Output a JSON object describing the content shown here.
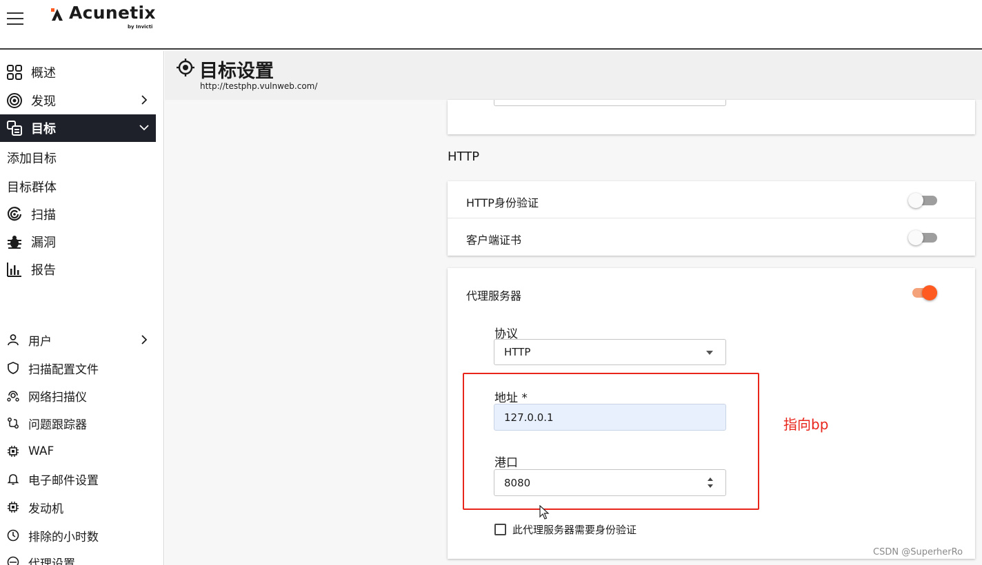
{
  "brand": {
    "name": "Acunetix",
    "sub": "by Invicti",
    "accent": "#ff5a1f"
  },
  "sidebar": {
    "main_items": [
      {
        "label": "概述",
        "icon": "dashboard-icon"
      },
      {
        "label": "发现",
        "icon": "discovery-target-icon"
      },
      {
        "label": "目标",
        "icon": "targets-icon"
      },
      {
        "label": "扫描",
        "icon": "scan-icon"
      },
      {
        "label": "漏洞",
        "icon": "bug-icon"
      },
      {
        "label": "报告",
        "icon": "report-chart-icon"
      }
    ],
    "sub_items": [
      "添加目标",
      "目标群体"
    ],
    "settings_items": [
      {
        "label": "用户",
        "icon": "user-icon"
      },
      {
        "label": "扫描配置文件",
        "icon": "shield-icon"
      },
      {
        "label": "网络扫描仪",
        "icon": "network-scanner-icon"
      },
      {
        "label": "问题跟踪器",
        "icon": "issue-tracker-icon"
      },
      {
        "label": "WAF",
        "icon": "chip-icon"
      },
      {
        "label": "电子邮件设置",
        "icon": "bell-icon"
      },
      {
        "label": "发动机",
        "icon": "engine-chip-icon"
      },
      {
        "label": "排除的小时数",
        "icon": "clock-icon"
      },
      {
        "label": "代理设置",
        "icon": "proxy-icon"
      }
    ]
  },
  "page": {
    "title": "目标设置",
    "url": "http://testphp.vulnweb.com/"
  },
  "http_section": {
    "title": "HTTP",
    "http_auth_label": "HTTP身份验证",
    "http_auth_on": false,
    "client_cert_label": "客户端证书",
    "client_cert_on": false
  },
  "proxy": {
    "title": "代理服务器",
    "enabled": true,
    "protocol_label": "协议",
    "protocol_value": "HTTP",
    "address_label": "地址 *",
    "address_value": "127.0.0.1",
    "port_label": "港口",
    "port_value": "8080",
    "auth_checkbox_label": "此代理服务器需要身份验证",
    "auth_required": false
  },
  "annotation": {
    "text": "指向bp",
    "color": "#e8251b"
  },
  "watermark": "CSDN @SuperherRo"
}
